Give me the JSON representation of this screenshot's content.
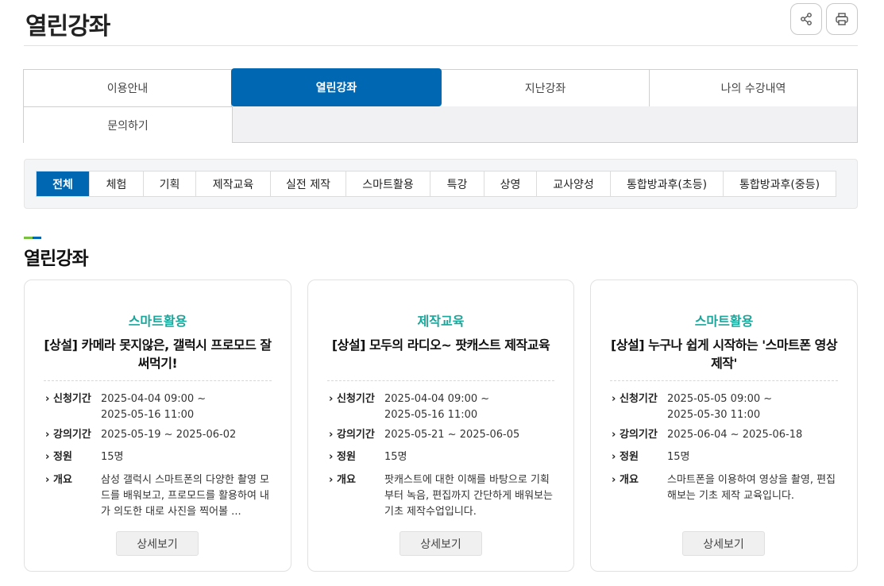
{
  "header": {
    "title": "열린강좌",
    "share_icon": "share-icon",
    "print_icon": "print-icon"
  },
  "tabs": [
    {
      "label": "이용안내",
      "active": false
    },
    {
      "label": "열린강좌",
      "active": true
    },
    {
      "label": "지난강좌",
      "active": false
    },
    {
      "label": "나의 수강내역",
      "active": false
    },
    {
      "label": "문의하기",
      "active": false
    }
  ],
  "categories": [
    {
      "label": "전체",
      "active": true
    },
    {
      "label": "체험",
      "active": false
    },
    {
      "label": "기획",
      "active": false
    },
    {
      "label": "제작교육",
      "active": false
    },
    {
      "label": "실전 제작",
      "active": false
    },
    {
      "label": "스마트활용",
      "active": false
    },
    {
      "label": "특강",
      "active": false
    },
    {
      "label": "상영",
      "active": false
    },
    {
      "label": "교사양성",
      "active": false
    },
    {
      "label": "통합방과후(초등)",
      "active": false
    },
    {
      "label": "통합방과후(중등)",
      "active": false
    }
  ],
  "section": {
    "title": "열린강좌",
    "colors": {
      "accent_green": "#7ac143",
      "accent_blue": "#0067b3"
    }
  },
  "labels": {
    "apply_period": "신청기간",
    "lecture_period": "강의기간",
    "capacity": "정원",
    "summary": "개요",
    "detail_button": "상세보기"
  },
  "cards": [
    {
      "category": "스마트활용",
      "title": "[상설] 카메라 못지않은, 갤럭시 프로모드 잘 써먹기!",
      "apply_start": "2025-04-04 09:00 ~",
      "apply_end": "2025-05-16 11:00",
      "lecture_period": "2025-05-19 ~ 2025-06-02",
      "capacity": "15명",
      "summary": "삼성 갤럭시 스마트폰의 다양한 촬영 모드를 배워보고, 프로모드를 활용하여 내가 의도한 대로 사진을 찍어볼 ..."
    },
    {
      "category": "제작교육",
      "title": "[상설] 모두의 라디오~ 팟캐스트 제작교육",
      "apply_start": "2025-04-04 09:00 ~",
      "apply_end": "2025-05-16 11:00",
      "lecture_period": "2025-05-21 ~ 2025-06-05",
      "capacity": "15명",
      "summary": "팟캐스트에 대한 이해를 바탕으로 기획부터 녹음, 편집까지 간단하게 배워보는 기초 제작수업입니다."
    },
    {
      "category": "스마트활용",
      "title": "[상설] 누구나 쉽게 시작하는 '스마트폰 영상제작'",
      "apply_start": "2025-05-05 09:00 ~",
      "apply_end": "2025-05-30 11:00",
      "lecture_period": "2025-06-04 ~ 2025-06-18",
      "capacity": "15명",
      "summary": "스마트폰을 이용하여 영상을 촬영, 편집해보는 기초 제작 교육입니다."
    }
  ]
}
